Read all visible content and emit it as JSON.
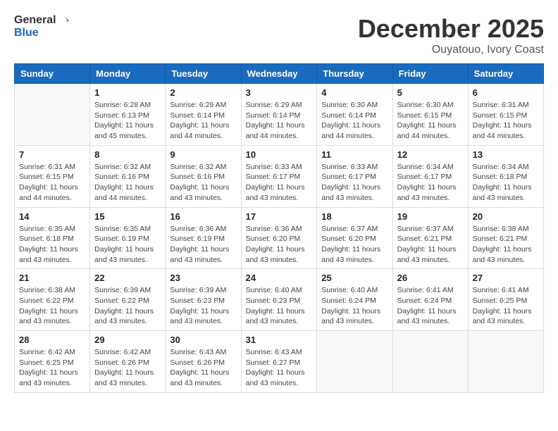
{
  "logo": {
    "general": "General",
    "blue": "Blue"
  },
  "header": {
    "month": "December 2025",
    "location": "Ouyatouo, Ivory Coast"
  },
  "weekdays": [
    "Sunday",
    "Monday",
    "Tuesday",
    "Wednesday",
    "Thursday",
    "Friday",
    "Saturday"
  ],
  "weeks": [
    [
      {
        "day": "",
        "sunrise": "",
        "sunset": "",
        "daylight": ""
      },
      {
        "day": "1",
        "sunrise": "Sunrise: 6:28 AM",
        "sunset": "Sunset: 6:13 PM",
        "daylight": "Daylight: 11 hours and 45 minutes."
      },
      {
        "day": "2",
        "sunrise": "Sunrise: 6:29 AM",
        "sunset": "Sunset: 6:14 PM",
        "daylight": "Daylight: 11 hours and 44 minutes."
      },
      {
        "day": "3",
        "sunrise": "Sunrise: 6:29 AM",
        "sunset": "Sunset: 6:14 PM",
        "daylight": "Daylight: 11 hours and 44 minutes."
      },
      {
        "day": "4",
        "sunrise": "Sunrise: 6:30 AM",
        "sunset": "Sunset: 6:14 PM",
        "daylight": "Daylight: 11 hours and 44 minutes."
      },
      {
        "day": "5",
        "sunrise": "Sunrise: 6:30 AM",
        "sunset": "Sunset: 6:15 PM",
        "daylight": "Daylight: 11 hours and 44 minutes."
      },
      {
        "day": "6",
        "sunrise": "Sunrise: 6:31 AM",
        "sunset": "Sunset: 6:15 PM",
        "daylight": "Daylight: 11 hours and 44 minutes."
      }
    ],
    [
      {
        "day": "7",
        "sunrise": "Sunrise: 6:31 AM",
        "sunset": "Sunset: 6:15 PM",
        "daylight": "Daylight: 11 hours and 44 minutes."
      },
      {
        "day": "8",
        "sunrise": "Sunrise: 6:32 AM",
        "sunset": "Sunset: 6:16 PM",
        "daylight": "Daylight: 11 hours and 44 minutes."
      },
      {
        "day": "9",
        "sunrise": "Sunrise: 6:32 AM",
        "sunset": "Sunset: 6:16 PM",
        "daylight": "Daylight: 11 hours and 43 minutes."
      },
      {
        "day": "10",
        "sunrise": "Sunrise: 6:33 AM",
        "sunset": "Sunset: 6:17 PM",
        "daylight": "Daylight: 11 hours and 43 minutes."
      },
      {
        "day": "11",
        "sunrise": "Sunrise: 6:33 AM",
        "sunset": "Sunset: 6:17 PM",
        "daylight": "Daylight: 11 hours and 43 minutes."
      },
      {
        "day": "12",
        "sunrise": "Sunrise: 6:34 AM",
        "sunset": "Sunset: 6:17 PM",
        "daylight": "Daylight: 11 hours and 43 minutes."
      },
      {
        "day": "13",
        "sunrise": "Sunrise: 6:34 AM",
        "sunset": "Sunset: 6:18 PM",
        "daylight": "Daylight: 11 hours and 43 minutes."
      }
    ],
    [
      {
        "day": "14",
        "sunrise": "Sunrise: 6:35 AM",
        "sunset": "Sunset: 6:18 PM",
        "daylight": "Daylight: 11 hours and 43 minutes."
      },
      {
        "day": "15",
        "sunrise": "Sunrise: 6:35 AM",
        "sunset": "Sunset: 6:19 PM",
        "daylight": "Daylight: 11 hours and 43 minutes."
      },
      {
        "day": "16",
        "sunrise": "Sunrise: 6:36 AM",
        "sunset": "Sunset: 6:19 PM",
        "daylight": "Daylight: 11 hours and 43 minutes."
      },
      {
        "day": "17",
        "sunrise": "Sunrise: 6:36 AM",
        "sunset": "Sunset: 6:20 PM",
        "daylight": "Daylight: 11 hours and 43 minutes."
      },
      {
        "day": "18",
        "sunrise": "Sunrise: 6:37 AM",
        "sunset": "Sunset: 6:20 PM",
        "daylight": "Daylight: 11 hours and 43 minutes."
      },
      {
        "day": "19",
        "sunrise": "Sunrise: 6:37 AM",
        "sunset": "Sunset: 6:21 PM",
        "daylight": "Daylight: 11 hours and 43 minutes."
      },
      {
        "day": "20",
        "sunrise": "Sunrise: 6:38 AM",
        "sunset": "Sunset: 6:21 PM",
        "daylight": "Daylight: 11 hours and 43 minutes."
      }
    ],
    [
      {
        "day": "21",
        "sunrise": "Sunrise: 6:38 AM",
        "sunset": "Sunset: 6:22 PM",
        "daylight": "Daylight: 11 hours and 43 minutes."
      },
      {
        "day": "22",
        "sunrise": "Sunrise: 6:39 AM",
        "sunset": "Sunset: 6:22 PM",
        "daylight": "Daylight: 11 hours and 43 minutes."
      },
      {
        "day": "23",
        "sunrise": "Sunrise: 6:39 AM",
        "sunset": "Sunset: 6:23 PM",
        "daylight": "Daylight: 11 hours and 43 minutes."
      },
      {
        "day": "24",
        "sunrise": "Sunrise: 6:40 AM",
        "sunset": "Sunset: 6:23 PM",
        "daylight": "Daylight: 11 hours and 43 minutes."
      },
      {
        "day": "25",
        "sunrise": "Sunrise: 6:40 AM",
        "sunset": "Sunset: 6:24 PM",
        "daylight": "Daylight: 11 hours and 43 minutes."
      },
      {
        "day": "26",
        "sunrise": "Sunrise: 6:41 AM",
        "sunset": "Sunset: 6:24 PM",
        "daylight": "Daylight: 11 hours and 43 minutes."
      },
      {
        "day": "27",
        "sunrise": "Sunrise: 6:41 AM",
        "sunset": "Sunset: 6:25 PM",
        "daylight": "Daylight: 11 hours and 43 minutes."
      }
    ],
    [
      {
        "day": "28",
        "sunrise": "Sunrise: 6:42 AM",
        "sunset": "Sunset: 6:25 PM",
        "daylight": "Daylight: 11 hours and 43 minutes."
      },
      {
        "day": "29",
        "sunrise": "Sunrise: 6:42 AM",
        "sunset": "Sunset: 6:26 PM",
        "daylight": "Daylight: 11 hours and 43 minutes."
      },
      {
        "day": "30",
        "sunrise": "Sunrise: 6:43 AM",
        "sunset": "Sunset: 6:26 PM",
        "daylight": "Daylight: 11 hours and 43 minutes."
      },
      {
        "day": "31",
        "sunrise": "Sunrise: 6:43 AM",
        "sunset": "Sunset: 6:27 PM",
        "daylight": "Daylight: 11 hours and 43 minutes."
      },
      {
        "day": "",
        "sunrise": "",
        "sunset": "",
        "daylight": ""
      },
      {
        "day": "",
        "sunrise": "",
        "sunset": "",
        "daylight": ""
      },
      {
        "day": "",
        "sunrise": "",
        "sunset": "",
        "daylight": ""
      }
    ]
  ]
}
